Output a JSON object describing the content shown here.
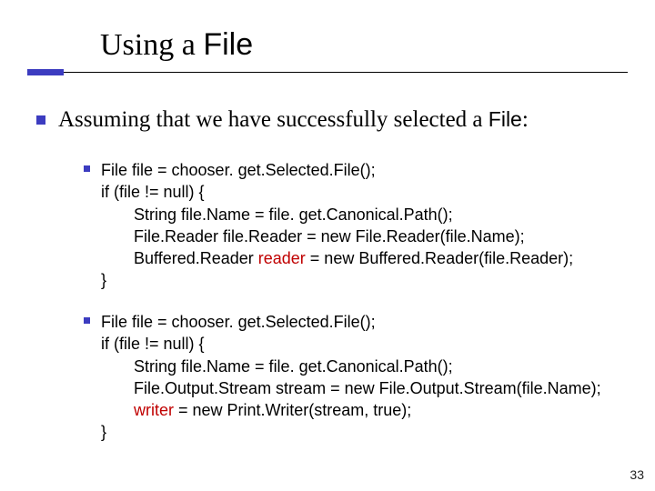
{
  "title": {
    "prefix": "Using a ",
    "file_word": "File"
  },
  "main_bullet": {
    "prefix": "Assuming that we have successfully selected a ",
    "file_word": "File",
    "colon": ":"
  },
  "code1": {
    "l1": "File file = chooser. get.Selected.File();",
    "l2": "if (file != null) {",
    "l3": "String file.Name = file. get.Canonical.Path();",
    "l4": "File.Reader file.Reader = new File.Reader(file.Name);",
    "l5a": "Buffered.Reader ",
    "l5_kw": "reader",
    "l5b": " = new Buffered.Reader(file.Reader);",
    "l6": "}"
  },
  "code2": {
    "l1": "File file = chooser. get.Selected.File();",
    "l2": "if (file != null) {",
    "l3": "String file.Name = file. get.Canonical.Path();",
    "l4": "File.Output.Stream stream = new File.Output.Stream(file.Name);",
    "l5_kw": "writer",
    "l5b": " = new Print.Writer(stream, true);",
    "l6": "}"
  },
  "page_number": "33"
}
